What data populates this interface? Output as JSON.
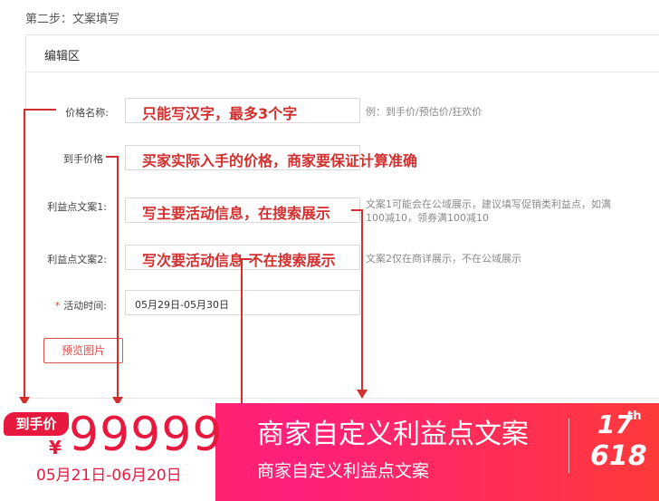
{
  "step_title": "第二步：文案填写",
  "panel": {
    "title": "编辑区"
  },
  "form": {
    "price_name": {
      "label": "价格名称:",
      "overlay": "只能写汉字，最多3个字",
      "hint": "例：到手价/预估价/狂欢价"
    },
    "hand_price": {
      "label": "到手价格",
      "overlay": "买家实际入手的价格，商家要保证计算准确"
    },
    "benefit1": {
      "label": "利益点文案1:",
      "overlay": "写主要活动信息，在搜索展示",
      "hint_line1": "文案1可能会在公域展示，建议填写促销类利益点，如满",
      "hint_line2": "100减10，领券满100减10"
    },
    "benefit2": {
      "label": "利益点文案2:",
      "overlay": "写次要活动信息 不在搜索展示",
      "hint": "文案2仅在商详展示，不在公域展示"
    },
    "activity_time": {
      "required_mark": "*",
      "label": "活动时间:",
      "value": "05月29日-05月30日"
    },
    "preview_button": "预览图片"
  },
  "banner": {
    "tag": "到手价",
    "currency": "¥",
    "price": "99999",
    "date_range": "05月21日-06月20日",
    "title": "商家自定义利益点文案",
    "subtitle": "商家自定义利益点文案",
    "logo_num": "17",
    "logo_sup": "th",
    "logo_618": "618"
  },
  "colors": {
    "accent_red": "#d32f2f",
    "banner_pink": "#ff1f7a",
    "price_red": "#e8193f"
  }
}
